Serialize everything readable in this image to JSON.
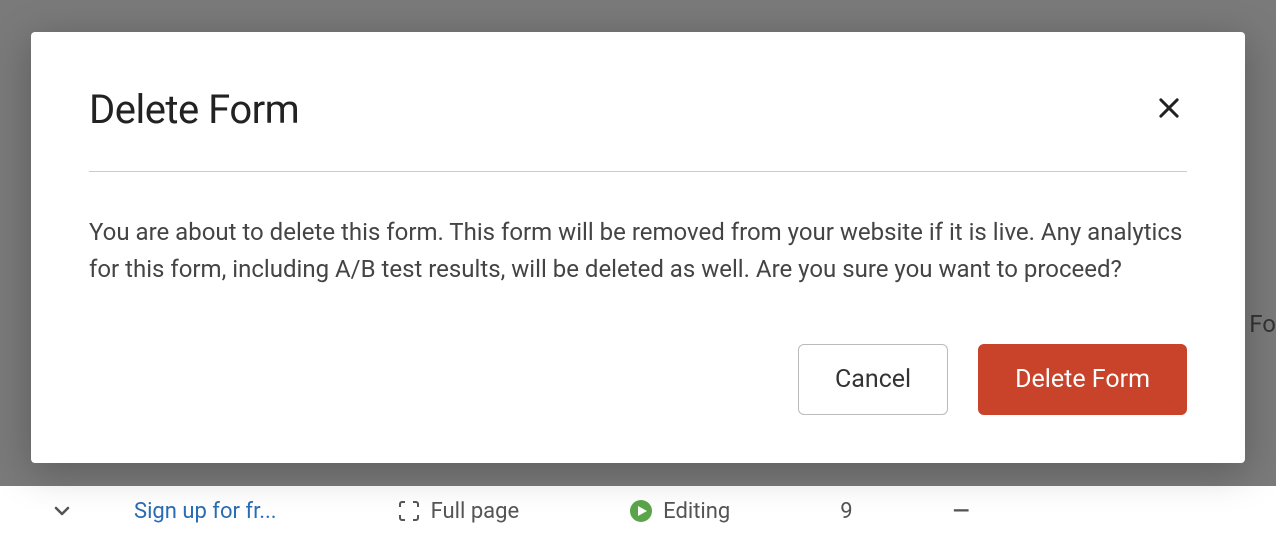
{
  "modal": {
    "title": "Delete Form",
    "body": "You are about to delete this form. This form will be removed from your website if it is live. Any analytics for this form, including A/B test results, will be deleted as well. Are you sure you want to proceed?",
    "cancel_label": "Cancel",
    "confirm_label": "Delete Form"
  },
  "background": {
    "link_text": "Sign up for fr...",
    "full_page_label": "Full page",
    "editing_label": "Editing",
    "count": "9",
    "dash": "—",
    "right_text": "Fo"
  }
}
